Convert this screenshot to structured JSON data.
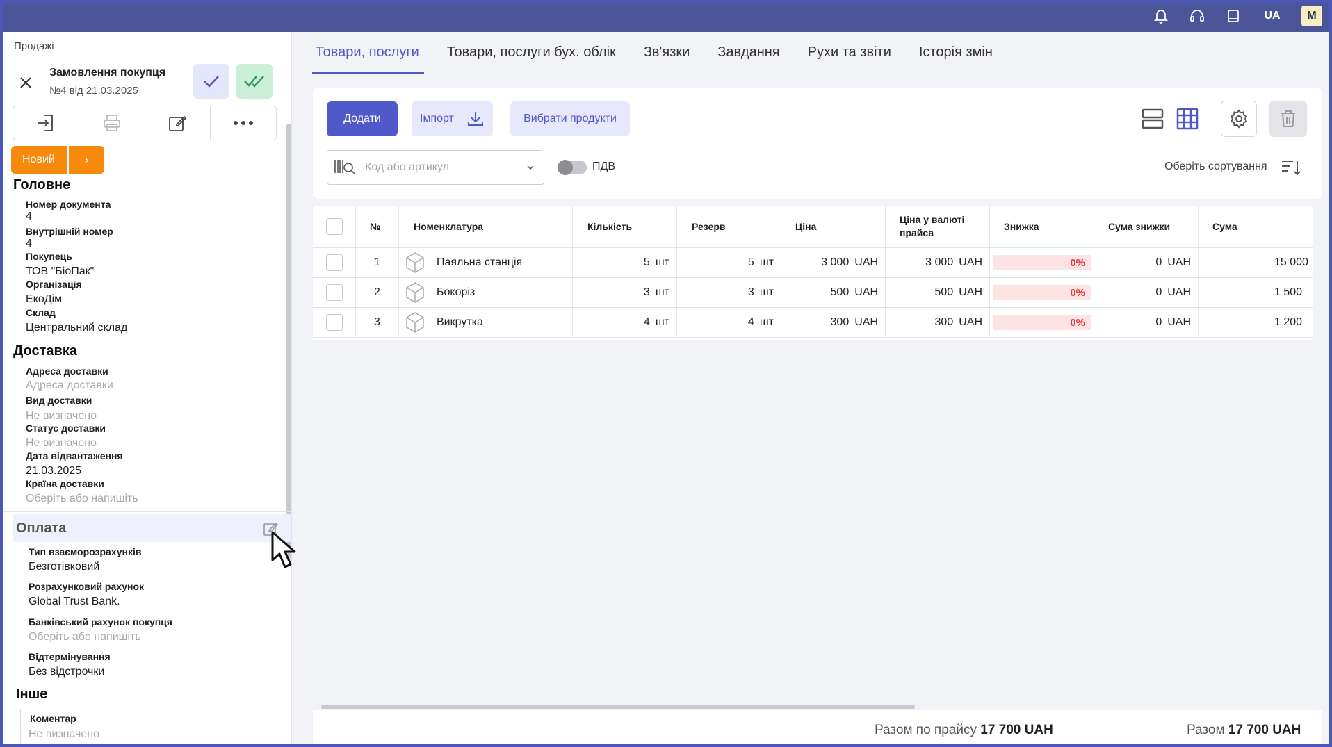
{
  "topbar": {
    "lang": "UA",
    "avatar": "M"
  },
  "sidebar": {
    "breadcrumb": "Продажі",
    "doc_title": "Замовлення покупця",
    "doc_subtitle": "№4 від 21.03.2025",
    "status": "Новий",
    "status_next": "›",
    "main": {
      "heading": "Головне",
      "fields": [
        {
          "label": "Номер документа",
          "value": "4"
        },
        {
          "label": "Внутрішній номер",
          "value": "4"
        },
        {
          "label": "Покупець",
          "value": "ТОВ \"БіоПак\""
        },
        {
          "label": "Організація",
          "value": "ЕкоДім"
        },
        {
          "label": "Склад",
          "value": "Центральний склад"
        }
      ]
    },
    "delivery": {
      "heading": "Доставка",
      "fields": [
        {
          "label": "Адреса доставки",
          "placeholder": "Адреса доставки"
        },
        {
          "label": "Вид доставки",
          "placeholder": "Не визначено"
        },
        {
          "label": "Статус доставки",
          "placeholder": "Не визначено"
        },
        {
          "label": "Дата відвантаження",
          "value": "21.03.2025"
        },
        {
          "label": "Країна доставки",
          "placeholder": "Оберіть або напишіть"
        }
      ]
    },
    "payment": {
      "heading": "Оплата",
      "fields": [
        {
          "label": "Тип взаєморозрахунків",
          "value": "Безготівковий"
        },
        {
          "label": "Розрахунковий рахунок",
          "value": "Global Trust Bank."
        },
        {
          "label": "Банківський рахунок покупця",
          "placeholder": "Оберіть або напишіть"
        },
        {
          "label": "Відтермінування",
          "value": "Без відстрочки"
        }
      ]
    },
    "other": {
      "heading": "Інше",
      "fields": [
        {
          "label": "Коментар",
          "placeholder": "Не визначено"
        }
      ]
    }
  },
  "tabs": [
    "Товари, послуги",
    "Товари, послуги бух. облік",
    "Зв'язки",
    "Завдання",
    "Рухи та звіти",
    "Історія змін"
  ],
  "toolbar": {
    "add": "Додати",
    "import": "Імпорт",
    "choose_products": "Вибрати продукти",
    "code_placeholder": "Код або артикул",
    "vat": "ПДВ",
    "sort": "Оберіть сортування"
  },
  "table": {
    "headers": [
      "№",
      "Номенклатура",
      "Кількість",
      "Резерв",
      "Ціна",
      "Ціна у валюті прайса",
      "Знижка",
      "Сума знижки",
      "Сума"
    ],
    "rows": [
      {
        "n": "1",
        "name": "Паяльна станція",
        "qty": "5",
        "unit": "шт",
        "reserve": "5",
        "price": "3 000",
        "cur": "UAH",
        "price_list": "3 000",
        "discount": "0%",
        "disc_sum": "0",
        "sum": "15 000"
      },
      {
        "n": "2",
        "name": "Бокоріз",
        "qty": "3",
        "unit": "шт",
        "reserve": "3",
        "price": "500",
        "cur": "UAH",
        "price_list": "500",
        "discount": "0%",
        "disc_sum": "0",
        "sum": "1 500"
      },
      {
        "n": "3",
        "name": "Викрутка",
        "qty": "4",
        "unit": "шт",
        "reserve": "4",
        "price": "300",
        "cur": "UAH",
        "price_list": "300",
        "discount": "0%",
        "disc_sum": "0",
        "sum": "1 200"
      }
    ]
  },
  "totals": {
    "price_list_label": "Разом по прайсу",
    "price_list_value": "17 700 UAH",
    "total_label": "Разом",
    "total_value": "17 700 UAH"
  },
  "colors": {
    "accent": "#5059c9",
    "topbar": "#4b5699",
    "status": "#f58a0c",
    "discount_bg": "#fde3e3",
    "discount_text": "#e53935"
  }
}
